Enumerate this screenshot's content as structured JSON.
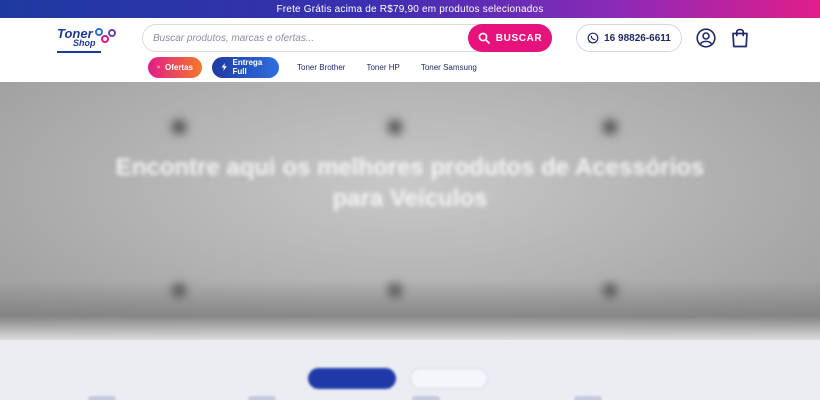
{
  "promo_bar": {
    "text": "Frete Grátis acima de R$79,90 em produtos selecionados"
  },
  "header": {
    "logo": {
      "line1": "Toner",
      "line2": "Shop"
    },
    "search": {
      "placeholder": "Buscar produtos, marcas e ofertas...",
      "value": "",
      "button_label": "BUSCAR"
    },
    "phone": {
      "number": "16 98826-6611",
      "icon": "whatsapp-icon"
    },
    "icons": [
      "user-icon",
      "shopping-bag-icon"
    ]
  },
  "nav": {
    "pills": [
      {
        "label": "Ofertas",
        "icon": "offer-badge-icon"
      },
      {
        "label": "Entrega Full",
        "icon": "lightning-icon"
      }
    ],
    "links": [
      "Toner Brother",
      "Toner HP",
      "Toner Samsung"
    ]
  },
  "hero": {
    "kicker": "",
    "title": "Encontre aqui os melhores produtos de Acessórios para Veículos"
  },
  "tabs": {
    "active": "",
    "inactive": ""
  },
  "colors": {
    "brand_blue": "#1f3aa8",
    "brand_pink": "#e6137d",
    "promo_orange": "#f27a2a"
  }
}
